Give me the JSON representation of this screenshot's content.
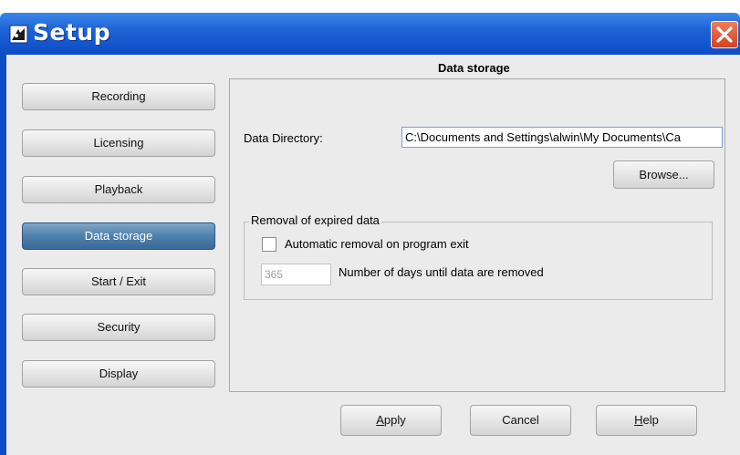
{
  "window": {
    "title": "Setup",
    "close_icon": "close-x-icon",
    "app_icon": "setup-app-icon"
  },
  "sidebar": {
    "items": [
      {
        "label": "Recording",
        "active": false
      },
      {
        "label": "Licensing",
        "active": false
      },
      {
        "label": "Playback",
        "active": false
      },
      {
        "label": "Data storage",
        "active": true
      },
      {
        "label": "Start / Exit",
        "active": false
      },
      {
        "label": "Security",
        "active": false
      },
      {
        "label": "Display",
        "active": false
      }
    ]
  },
  "content": {
    "heading": "Data storage",
    "data_directory": {
      "label": "Data Directory:",
      "value": "C:\\Documents and Settings\\alwin\\My Documents\\Ca"
    },
    "browse_label": "Browse...",
    "removal_group": {
      "title": "Removal of expired data",
      "auto_remove_label": "Automatic removal on program exit",
      "auto_remove_checked": false,
      "days_value": "365",
      "days_label": "Number of days until data are removed"
    }
  },
  "footer": {
    "apply_first": "A",
    "apply_rest": "pply",
    "cancel_label": "Cancel",
    "help_first": "H",
    "help_rest": "elp"
  },
  "colors": {
    "titlebar": "#0c4cc6",
    "active_nav": "#4f80ab",
    "close_button": "#d6431f",
    "client_bg": "#ebebeb"
  }
}
